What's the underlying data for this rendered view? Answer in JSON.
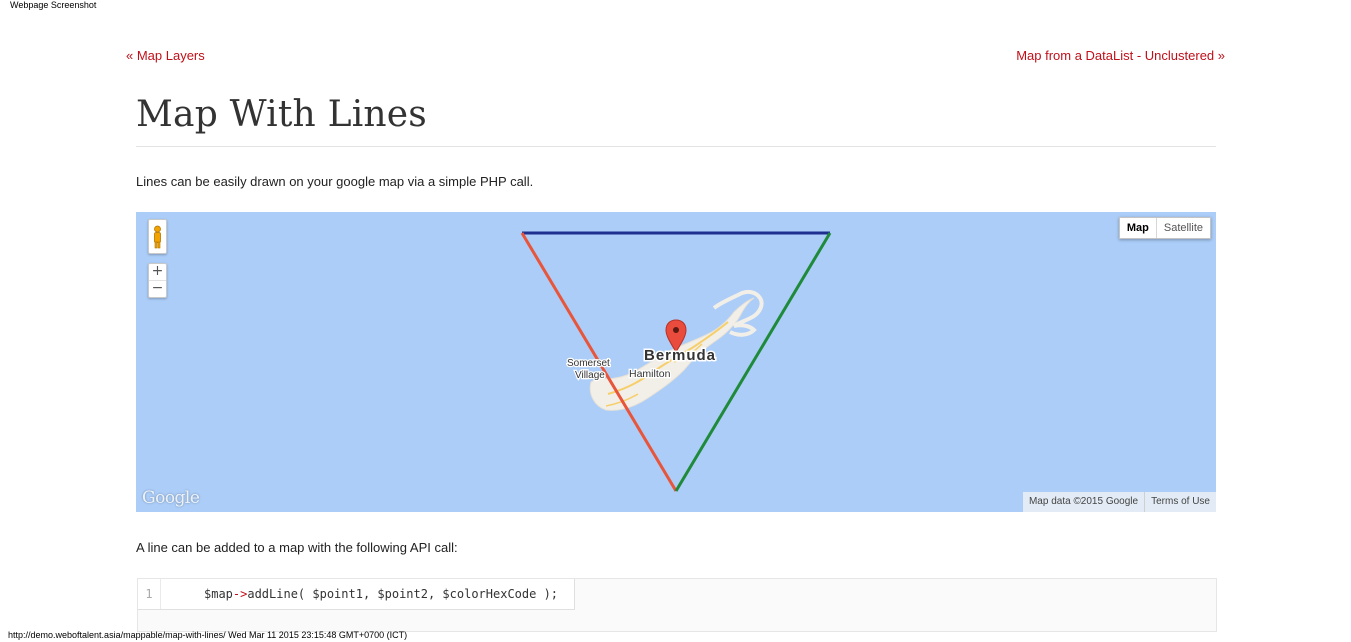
{
  "capture": {
    "title": "Webpage Screenshot",
    "footer": "http://demo.weboftalent.asia/mappable/map-with-lines/ Wed Mar 11 2015 23:15:48 GMT+0700 (ICT)"
  },
  "nav": {
    "prev_label": "« Map Layers",
    "next_label": "Map from a DataList - Unclustered »"
  },
  "page": {
    "title": "Map With Lines",
    "intro": "Lines can be easily drawn on your google map via a simple PHP call.",
    "api_intro": "A line can be added to a map with the following API call:"
  },
  "map": {
    "type_controls": [
      "Map",
      "Satellite"
    ],
    "active_type": "Map",
    "zoom_in": "+",
    "zoom_out": "−",
    "labels": {
      "island": "Bermuda",
      "town1_line1": "Somerset",
      "town1_line2": "Village",
      "town2": "Hamilton"
    },
    "logo": "Google",
    "attribution": "Map data ©2015 Google",
    "terms": "Terms of Use",
    "colors": {
      "water": "#abcdf8",
      "land": "#f2efe9",
      "roads": "#f6cf6a",
      "line_top": "#1f2f8f",
      "line_left": "#e8553a",
      "line_right": "#1e8a3a",
      "marker": "#e94b3c"
    }
  },
  "code": {
    "line_number": "1",
    "var": "$map",
    "arrow": "->",
    "rest": "addLine( $point1, $point2, $colorHexCode );"
  }
}
